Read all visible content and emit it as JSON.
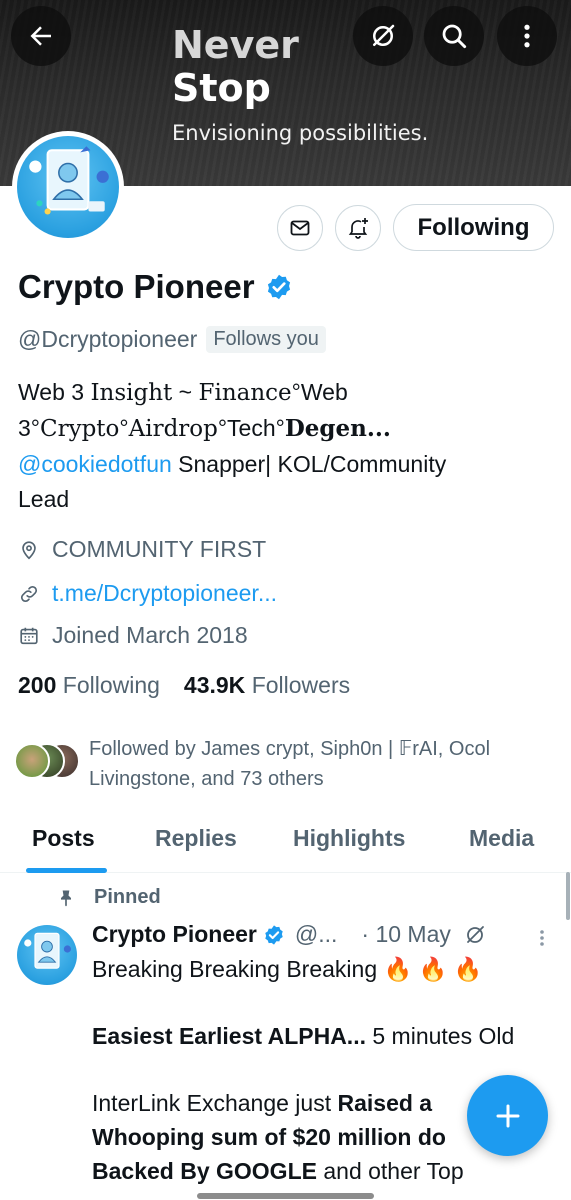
{
  "banner": {
    "title_line1": "Never",
    "title_line2": "Stop",
    "subtitle": "Envisioning possibilities."
  },
  "header_icons": [
    "back-arrow-icon",
    "grok-icon",
    "search-icon",
    "more-vertical-icon"
  ],
  "actions": {
    "following_label": "Following"
  },
  "profile": {
    "display_name": "Crypto Pioneer",
    "handle": "@Dcryptopioneer",
    "follows_you": "Follows you",
    "bio": {
      "line1_a": "Web 3 ",
      "line1_b": "Insight",
      "line1_c": " ~ ",
      "line1_d": "Finance",
      "line1_e": "°Web",
      "line2_a": "3°",
      "line2_b": "Crypto",
      "line2_c": "°",
      "line2_d": "Airdrop",
      "line2_e": "°Tech°",
      "line2_f": "Degen...",
      "mention": "@cookiedotfun",
      "line3_rest": " Snapper|  KOL/Community",
      "line4": "Lead"
    },
    "location": "COMMUNITY FIRST",
    "website": "t.me/Dcryptopioneer...",
    "joined": "Joined March 2018",
    "following_count": "200",
    "following_label": "Following",
    "followers_count": "43.9K",
    "followers_label": "Followers",
    "followed_by_line1": "Followed by James crypt, Siph0n | 𝔽rAI, Ocol",
    "followed_by_line2": "Livingstone, and 73 others"
  },
  "tabs": [
    {
      "label": "Posts",
      "active": true
    },
    {
      "label": "Replies",
      "active": false
    },
    {
      "label": "Highlights",
      "active": false
    },
    {
      "label": "Media",
      "active": false
    }
  ],
  "post": {
    "pinned_label": "Pinned",
    "author": "Crypto Pioneer",
    "handle": "@...",
    "date": "· 10 May",
    "line1": "Breaking Breaking Breaking 🔥 🔥 🔥",
    "line2_bold": "Easiest Earliest ALPHA...",
    "line2_rest": " 5 minutes Old",
    "line3_normal": "InterLink Exchange just ",
    "line3_bold": "Raised a",
    "line4_bold_a": "Whooping sum of ",
    "line4_normal": "$20 million do",
    "line5_bold": "Backed By GOOGLE",
    "line5_rest": " and other Top"
  },
  "colors": {
    "accent": "#1d9bf0",
    "text_primary": "#0f1419",
    "text_secondary": "#536471",
    "banner_dark": "#2b2b2b"
  }
}
